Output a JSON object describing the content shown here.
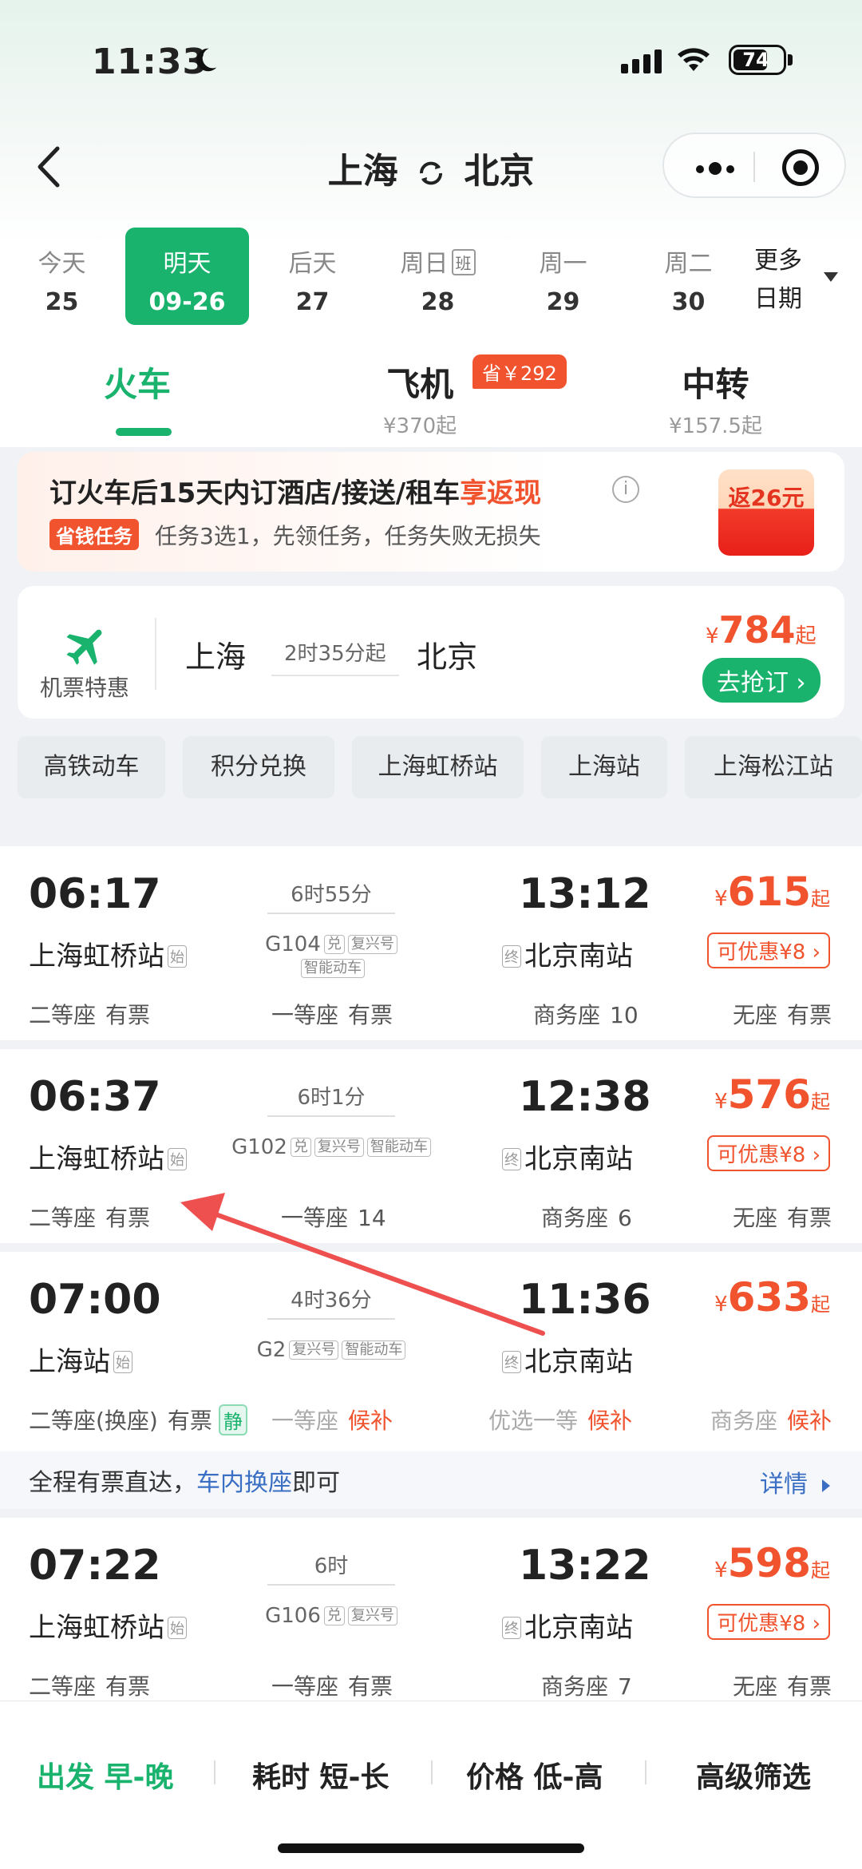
{
  "status_bar": {
    "time": "11:33",
    "battery": "74"
  },
  "header": {
    "from": "上海",
    "to": "北京"
  },
  "dates": [
    {
      "week": "今天",
      "day": "25",
      "selected": false
    },
    {
      "week": "明天",
      "day": "09-26",
      "selected": true
    },
    {
      "week": "后天",
      "day": "27",
      "selected": false
    },
    {
      "week": "周日",
      "day": "28",
      "badge": "班",
      "selected": false
    },
    {
      "week": "周一",
      "day": "29",
      "selected": false
    },
    {
      "week": "周二",
      "day": "30",
      "selected": false
    }
  ],
  "more_dates": {
    "line1": "更多",
    "line2": "日期"
  },
  "modes": [
    {
      "label": "火车",
      "sub": "",
      "active": true
    },
    {
      "label": "飞机",
      "sub": "¥370起",
      "badge": "省￥292"
    },
    {
      "label": "中转",
      "sub": "¥157.5起"
    }
  ],
  "promo": {
    "title_main": "订火车后15天内订酒店/接送/租车",
    "title_highlight": "享返现",
    "tag": "省钱任务",
    "desc": "任务3选1，先领任务，任务失败无损失",
    "redpack": "返26元"
  },
  "flight_deal": {
    "label": "机票特惠",
    "from": "上海",
    "duration": "2时35分起",
    "to": "北京",
    "currency": "¥",
    "price": "784",
    "suffix": "起",
    "button": "去抢订"
  },
  "filters": [
    "高铁动车",
    "积分兑换",
    "上海虹桥站",
    "上海站",
    "上海松江站"
  ],
  "trains": [
    {
      "dep": "06:17",
      "arr": "13:12",
      "from": "上海虹桥站",
      "from_tag": "始",
      "to": "北京南站",
      "to_tag": "终",
      "duration": "6时55分",
      "code": "G104",
      "labels": [
        "兑",
        "复兴号"
      ],
      "labels2": [
        "智能动车"
      ],
      "price": "615",
      "discount": "可优惠¥8",
      "seats": [
        {
          "name": "二等座",
          "avail": "有票"
        },
        {
          "name": "一等座",
          "avail": "有票"
        },
        {
          "name": "商务座",
          "avail": "10"
        },
        {
          "name": "无座",
          "avail": "有票"
        }
      ]
    },
    {
      "dep": "06:37",
      "arr": "12:38",
      "from": "上海虹桥站",
      "from_tag": "始",
      "to": "北京南站",
      "to_tag": "终",
      "duration": "6时1分",
      "code": "G102",
      "labels": [
        "兑",
        "复兴号",
        "智能动车"
      ],
      "labels2": [],
      "price": "576",
      "discount": "可优惠¥8",
      "seats": [
        {
          "name": "二等座",
          "avail": "有票"
        },
        {
          "name": "一等座",
          "avail": "14"
        },
        {
          "name": "商务座",
          "avail": "6"
        },
        {
          "name": "无座",
          "avail": "有票"
        }
      ]
    },
    {
      "dep": "07:00",
      "arr": "11:36",
      "from": "上海站",
      "from_tag": "始",
      "to": "北京南站",
      "to_tag": "终",
      "duration": "4时36分",
      "code": "G2",
      "labels": [
        "复兴号",
        "智能动车"
      ],
      "labels2": [],
      "price": "633",
      "discount": "",
      "seats": [
        {
          "name": "二等座(换座)",
          "avail": "有票",
          "extra": "静"
        },
        {
          "name": "一等座",
          "avail": "候补"
        },
        {
          "name": "优选一等",
          "avail": "候补"
        },
        {
          "name": "商务座",
          "avail": "候补"
        }
      ],
      "notice": {
        "pre": "全程有票直达，",
        "link": "车内换座",
        "post": "即可",
        "detail": "详情"
      }
    },
    {
      "dep": "07:22",
      "arr": "13:22",
      "from": "上海虹桥站",
      "from_tag": "始",
      "to": "北京南站",
      "to_tag": "终",
      "duration": "6时",
      "code": "G106",
      "labels": [
        "兑",
        "复兴号"
      ],
      "labels2": [],
      "price": "598",
      "discount": "可优惠¥8",
      "seats": [
        {
          "name": "二等座",
          "avail": "有票"
        },
        {
          "name": "一等座",
          "avail": "有票"
        },
        {
          "name": "商务座",
          "avail": "7"
        },
        {
          "name": "无座",
          "avail": "有票"
        }
      ]
    }
  ],
  "price_currency": "¥",
  "price_suffix": "起",
  "bottom_sort": [
    "出发 早-晚",
    "耗时 短-长",
    "价格 低-高",
    "高级筛选"
  ],
  "colors": {
    "accent": "#1ab36e",
    "price": "#f0532d",
    "link": "#3a6fc4"
  }
}
